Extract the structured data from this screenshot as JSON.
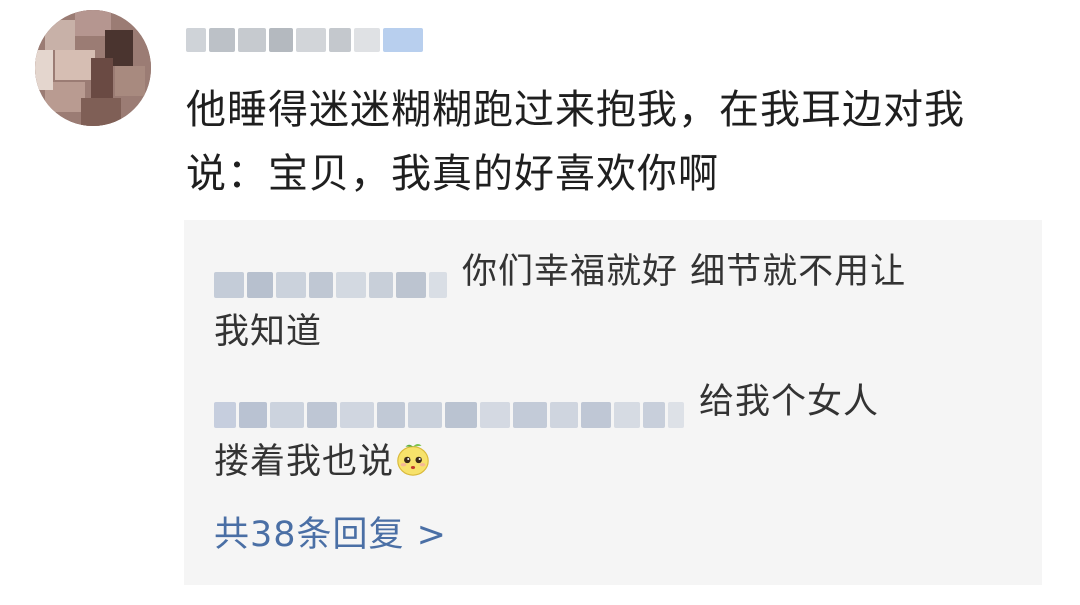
{
  "comment": {
    "line1": "他睡得迷迷糊糊跑过来抱我，在我耳边对我",
    "line2": "说：宝贝，我真的好喜欢你啊"
  },
  "replies": [
    {
      "text1": "你们幸福就好 细节就不用让",
      "text2": "我知道"
    },
    {
      "text1": "给我个女人",
      "text2": "搂着我也说",
      "emoji": "lemon-face-icon"
    }
  ],
  "more_replies_label": "共38条回复 >",
  "colors": {
    "reply_bg": "#f5f5f5",
    "link": "#4a6fa5",
    "text": "#1f1f1f"
  }
}
